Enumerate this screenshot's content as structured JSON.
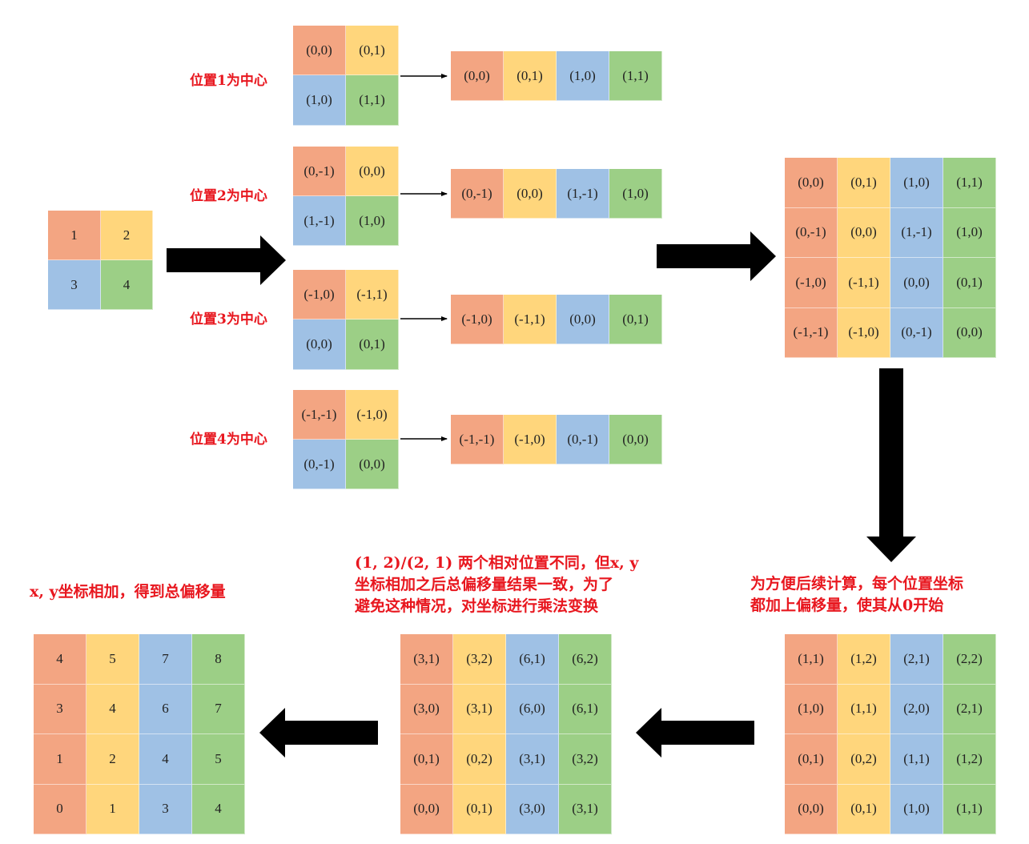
{
  "colors": {
    "red": "#f3a582",
    "yellow": "#ffd67c",
    "blue": "#9fc1e5",
    "green": "#9ccf86",
    "text_red": "#e8171f"
  },
  "input_grid": {
    "cells": [
      "1",
      "2",
      "3",
      "4"
    ]
  },
  "rows": [
    {
      "label": "位置1为中心",
      "cells": [
        "(0,0)",
        "(0,1)",
        "(1,0)",
        "(1,1)"
      ]
    },
    {
      "label": "位置2为中心",
      "cells": [
        "(0,-1)",
        "(0,0)",
        "(1,-1)",
        "(1,0)"
      ]
    },
    {
      "label": "位置3为中心",
      "cells": [
        "(-1,0)",
        "(-1,1)",
        "(0,0)",
        "(0,1)"
      ]
    },
    {
      "label": "位置4为中心",
      "cells": [
        "(-1,-1)",
        "(-1,0)",
        "(0,-1)",
        "(0,0)"
      ]
    }
  ],
  "combined_matrix": [
    [
      "(0,0)",
      "(0,1)",
      "(1,0)",
      "(1,1)"
    ],
    [
      "(0,-1)",
      "(0,0)",
      "(1,-1)",
      "(1,0)"
    ],
    [
      "(-1,0)",
      "(-1,1)",
      "(0,0)",
      "(0,1)"
    ],
    [
      "(-1,-1)",
      "(-1,0)",
      "(0,-1)",
      "(0,0)"
    ]
  ],
  "offset_matrix": [
    [
      "(1,1)",
      "(1,2)",
      "(2,1)",
      "(2,2)"
    ],
    [
      "(1,0)",
      "(1,1)",
      "(2,0)",
      "(2,1)"
    ],
    [
      "(0,1)",
      "(0,2)",
      "(1,1)",
      "(1,2)"
    ],
    [
      "(0,0)",
      "(0,1)",
      "(1,0)",
      "(1,1)"
    ]
  ],
  "scaled_matrix": [
    [
      "(3,1)",
      "(3,2)",
      "(6,1)",
      "(6,2)"
    ],
    [
      "(3,0)",
      "(3,1)",
      "(6,0)",
      "(6,1)"
    ],
    [
      "(0,1)",
      "(0,2)",
      "(3,1)",
      "(3,2)"
    ],
    [
      "(0,0)",
      "(0,1)",
      "(3,0)",
      "(3,1)"
    ]
  ],
  "sum_matrix": [
    [
      "4",
      "5",
      "7",
      "8"
    ],
    [
      "3",
      "4",
      "6",
      "7"
    ],
    [
      "1",
      "2",
      "4",
      "5"
    ],
    [
      "0",
      "1",
      "3",
      "4"
    ]
  ],
  "notes": {
    "offset": "为方便后续计算，每个位置坐标\n都加上偏移量，使其从0开始",
    "scale": "(1, 2)/(2, 1) 两个相对位置不同，但x, y\n坐标相加之后总偏移量结果一致，为了\n避免这种情况，对坐标进行乘法变换",
    "sum": "x, y坐标相加，得到总偏移量"
  }
}
